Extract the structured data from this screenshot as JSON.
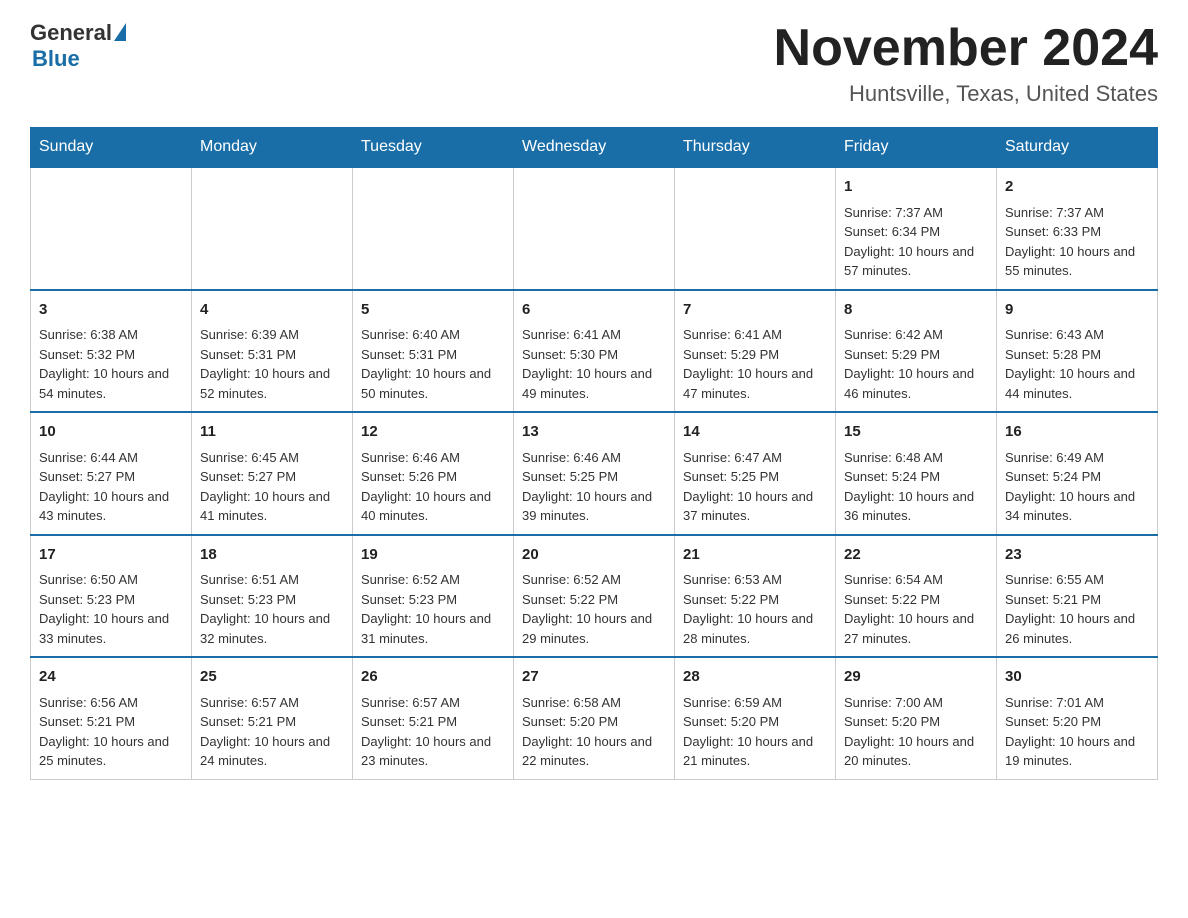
{
  "header": {
    "logo_general": "General",
    "logo_blue": "Blue",
    "month_title": "November 2024",
    "location": "Huntsville, Texas, United States"
  },
  "days_of_week": [
    "Sunday",
    "Monday",
    "Tuesday",
    "Wednesday",
    "Thursday",
    "Friday",
    "Saturday"
  ],
  "weeks": [
    [
      {
        "day": "",
        "info": ""
      },
      {
        "day": "",
        "info": ""
      },
      {
        "day": "",
        "info": ""
      },
      {
        "day": "",
        "info": ""
      },
      {
        "day": "",
        "info": ""
      },
      {
        "day": "1",
        "info": "Sunrise: 7:37 AM\nSunset: 6:34 PM\nDaylight: 10 hours and 57 minutes."
      },
      {
        "day": "2",
        "info": "Sunrise: 7:37 AM\nSunset: 6:33 PM\nDaylight: 10 hours and 55 minutes."
      }
    ],
    [
      {
        "day": "3",
        "info": "Sunrise: 6:38 AM\nSunset: 5:32 PM\nDaylight: 10 hours and 54 minutes."
      },
      {
        "day": "4",
        "info": "Sunrise: 6:39 AM\nSunset: 5:31 PM\nDaylight: 10 hours and 52 minutes."
      },
      {
        "day": "5",
        "info": "Sunrise: 6:40 AM\nSunset: 5:31 PM\nDaylight: 10 hours and 50 minutes."
      },
      {
        "day": "6",
        "info": "Sunrise: 6:41 AM\nSunset: 5:30 PM\nDaylight: 10 hours and 49 minutes."
      },
      {
        "day": "7",
        "info": "Sunrise: 6:41 AM\nSunset: 5:29 PM\nDaylight: 10 hours and 47 minutes."
      },
      {
        "day": "8",
        "info": "Sunrise: 6:42 AM\nSunset: 5:29 PM\nDaylight: 10 hours and 46 minutes."
      },
      {
        "day": "9",
        "info": "Sunrise: 6:43 AM\nSunset: 5:28 PM\nDaylight: 10 hours and 44 minutes."
      }
    ],
    [
      {
        "day": "10",
        "info": "Sunrise: 6:44 AM\nSunset: 5:27 PM\nDaylight: 10 hours and 43 minutes."
      },
      {
        "day": "11",
        "info": "Sunrise: 6:45 AM\nSunset: 5:27 PM\nDaylight: 10 hours and 41 minutes."
      },
      {
        "day": "12",
        "info": "Sunrise: 6:46 AM\nSunset: 5:26 PM\nDaylight: 10 hours and 40 minutes."
      },
      {
        "day": "13",
        "info": "Sunrise: 6:46 AM\nSunset: 5:25 PM\nDaylight: 10 hours and 39 minutes."
      },
      {
        "day": "14",
        "info": "Sunrise: 6:47 AM\nSunset: 5:25 PM\nDaylight: 10 hours and 37 minutes."
      },
      {
        "day": "15",
        "info": "Sunrise: 6:48 AM\nSunset: 5:24 PM\nDaylight: 10 hours and 36 minutes."
      },
      {
        "day": "16",
        "info": "Sunrise: 6:49 AM\nSunset: 5:24 PM\nDaylight: 10 hours and 34 minutes."
      }
    ],
    [
      {
        "day": "17",
        "info": "Sunrise: 6:50 AM\nSunset: 5:23 PM\nDaylight: 10 hours and 33 minutes."
      },
      {
        "day": "18",
        "info": "Sunrise: 6:51 AM\nSunset: 5:23 PM\nDaylight: 10 hours and 32 minutes."
      },
      {
        "day": "19",
        "info": "Sunrise: 6:52 AM\nSunset: 5:23 PM\nDaylight: 10 hours and 31 minutes."
      },
      {
        "day": "20",
        "info": "Sunrise: 6:52 AM\nSunset: 5:22 PM\nDaylight: 10 hours and 29 minutes."
      },
      {
        "day": "21",
        "info": "Sunrise: 6:53 AM\nSunset: 5:22 PM\nDaylight: 10 hours and 28 minutes."
      },
      {
        "day": "22",
        "info": "Sunrise: 6:54 AM\nSunset: 5:22 PM\nDaylight: 10 hours and 27 minutes."
      },
      {
        "day": "23",
        "info": "Sunrise: 6:55 AM\nSunset: 5:21 PM\nDaylight: 10 hours and 26 minutes."
      }
    ],
    [
      {
        "day": "24",
        "info": "Sunrise: 6:56 AM\nSunset: 5:21 PM\nDaylight: 10 hours and 25 minutes."
      },
      {
        "day": "25",
        "info": "Sunrise: 6:57 AM\nSunset: 5:21 PM\nDaylight: 10 hours and 24 minutes."
      },
      {
        "day": "26",
        "info": "Sunrise: 6:57 AM\nSunset: 5:21 PM\nDaylight: 10 hours and 23 minutes."
      },
      {
        "day": "27",
        "info": "Sunrise: 6:58 AM\nSunset: 5:20 PM\nDaylight: 10 hours and 22 minutes."
      },
      {
        "day": "28",
        "info": "Sunrise: 6:59 AM\nSunset: 5:20 PM\nDaylight: 10 hours and 21 minutes."
      },
      {
        "day": "29",
        "info": "Sunrise: 7:00 AM\nSunset: 5:20 PM\nDaylight: 10 hours and 20 minutes."
      },
      {
        "day": "30",
        "info": "Sunrise: 7:01 AM\nSunset: 5:20 PM\nDaylight: 10 hours and 19 minutes."
      }
    ]
  ]
}
